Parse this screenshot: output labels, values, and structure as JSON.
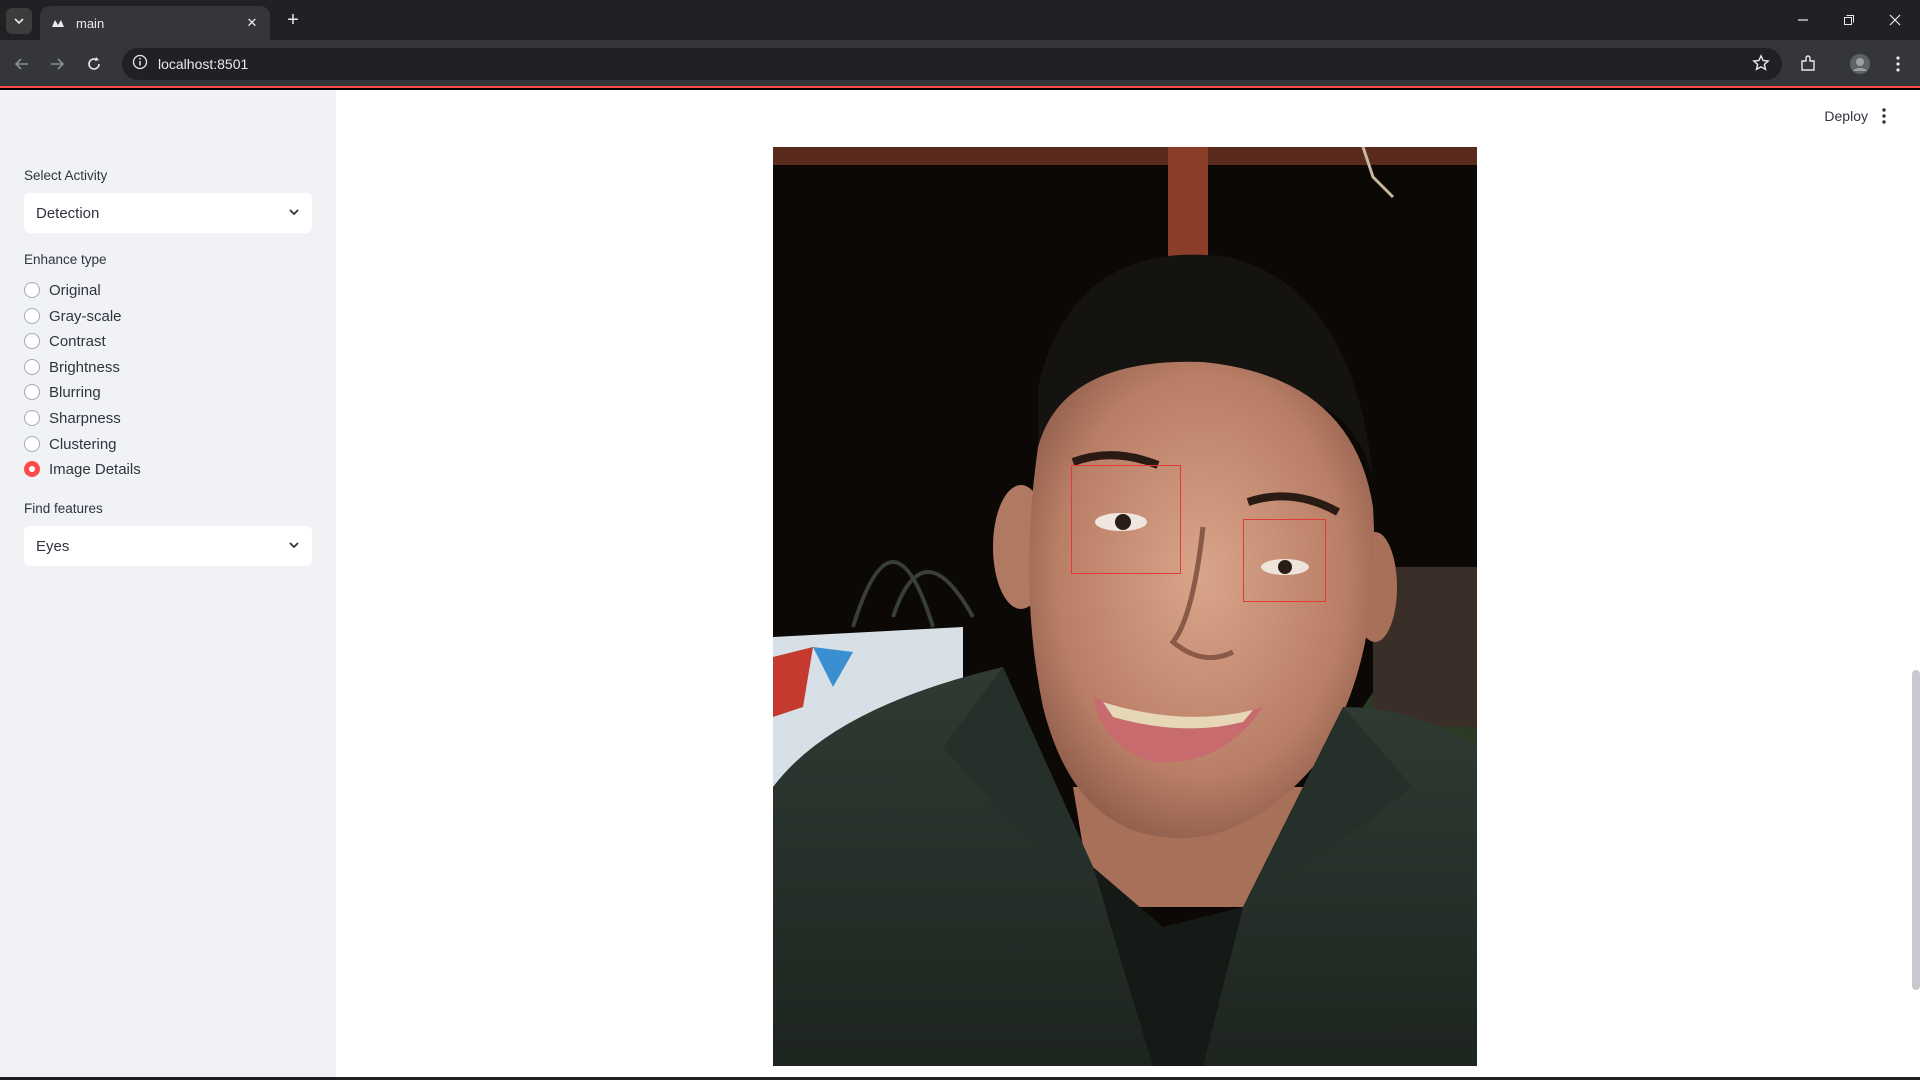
{
  "browser": {
    "tab_title": "main",
    "url": "localhost:8501"
  },
  "sidebar": {
    "activity_label": "Select Activity",
    "activity_value": "Detection",
    "enhance_label": "Enhance type",
    "enhance_options": [
      "Original",
      "Gray-scale",
      "Contrast",
      "Brightness",
      "Blurring",
      "Sharpness",
      "Clustering",
      "Image Details"
    ],
    "enhance_selected": "Image Details",
    "features_label": "Find features",
    "features_value": "Eyes"
  },
  "header": {
    "deploy_label": "Deploy"
  },
  "colors": {
    "accent": "#ff4b4b",
    "sidebar_bg": "#f0f2f6",
    "detection_box": "#e53935"
  }
}
